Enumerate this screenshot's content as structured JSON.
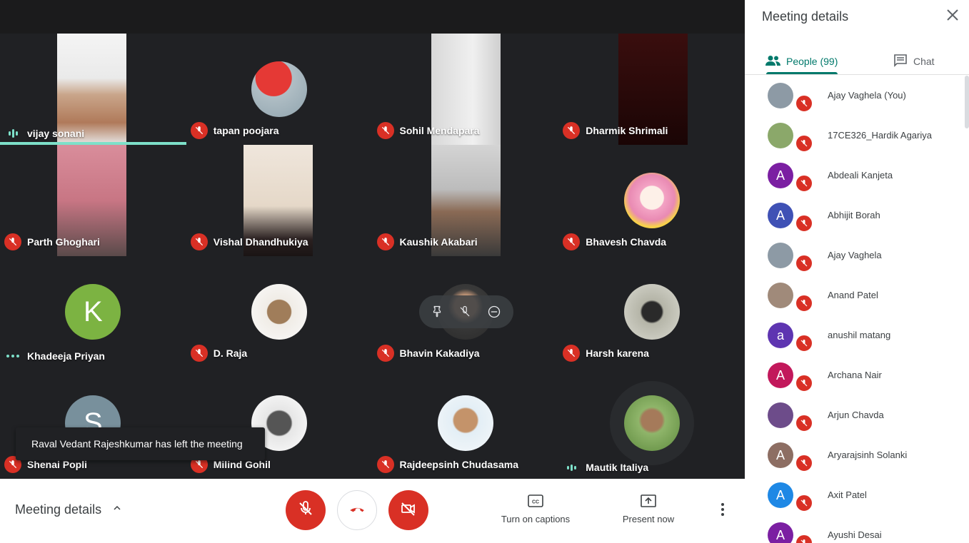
{
  "tiles": [
    {
      "name": "vijay sonani",
      "status": "speaking"
    },
    {
      "name": "tapan poojara",
      "status": "muted"
    },
    {
      "name": "Sohil Mendapara",
      "status": "muted"
    },
    {
      "name": "Dharmik Shrimali",
      "status": "muted"
    },
    {
      "name": "Parth Ghoghari",
      "status": "muted"
    },
    {
      "name": "Vishal Dhandhukiya",
      "status": "muted"
    },
    {
      "name": "Kaushik Akabari",
      "status": "muted"
    },
    {
      "name": "Bhavesh Chavda",
      "status": "muted"
    },
    {
      "name": "Khadeeja Priyan",
      "status": "audio",
      "initial": "K"
    },
    {
      "name": "D. Raja",
      "status": "muted"
    },
    {
      "name": "Bhavin Kakadiya",
      "status": "muted"
    },
    {
      "name": "Harsh karena",
      "status": "muted"
    },
    {
      "name": "Shenai Popli",
      "status": "muted",
      "initial": "S"
    },
    {
      "name": "Milind Gohil",
      "status": "muted"
    },
    {
      "name": "Rajdeepsinh Chudasama",
      "status": "muted"
    },
    {
      "name": "Mautik Italiya",
      "status": "speaking"
    }
  ],
  "toast": "Raval Vedant Rajeshkumar has left the meeting",
  "bottombar": {
    "meeting_details": "Meeting details",
    "captions": "Turn on captions",
    "present": "Present now"
  },
  "panel": {
    "title": "Meeting details",
    "people_tab": "People (99)",
    "chat_tab": "Chat",
    "people": [
      {
        "name": "Ajay Vaghela (You)",
        "initial": "",
        "color": "#8d9aa5"
      },
      {
        "name": "17CE326_Hardik Agariya",
        "initial": "",
        "color": "#8ba86a"
      },
      {
        "name": "Abdeali Kanjeta",
        "initial": "A",
        "color": "#7b1fa2"
      },
      {
        "name": "Abhijit Borah",
        "initial": "A",
        "color": "#3f51b5"
      },
      {
        "name": "Ajay Vaghela",
        "initial": "",
        "color": "#8d9aa5"
      },
      {
        "name": "Anand Patel",
        "initial": "",
        "color": "#a08a7a"
      },
      {
        "name": "anushil matang",
        "initial": "a",
        "color": "#5e35b1"
      },
      {
        "name": "Archana Nair",
        "initial": "A",
        "color": "#c2185b"
      },
      {
        "name": "Arjun Chavda",
        "initial": "",
        "color": "#6d4c8a"
      },
      {
        "name": "Aryarajsinh Solanki",
        "initial": "A",
        "color": "#8d6e63"
      },
      {
        "name": "Axit Patel",
        "initial": "A",
        "color": "#1e88e5"
      },
      {
        "name": "Ayushi Desai",
        "initial": "A",
        "color": "#7b1fa2"
      }
    ]
  }
}
